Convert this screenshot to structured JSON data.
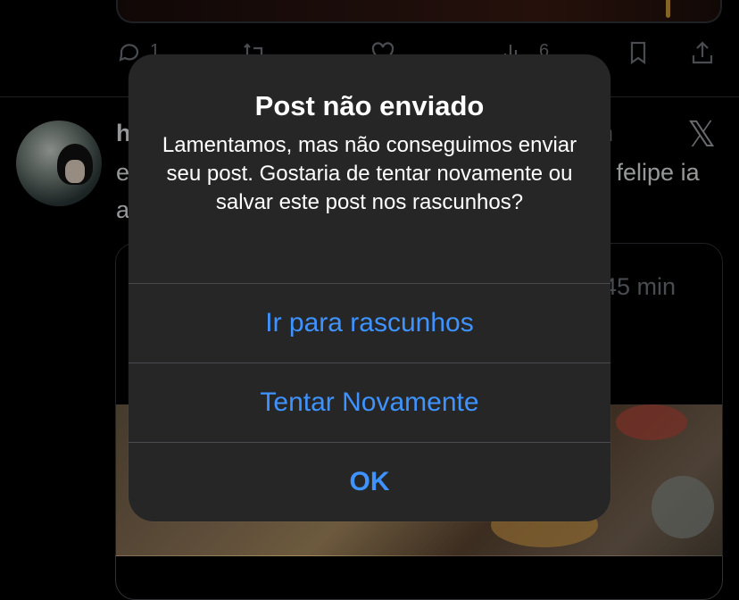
{
  "feed": {
    "actions": {
      "reply_count": "1",
      "views_count": "6"
    },
    "post": {
      "author_initial": "h",
      "line1_left": "e",
      "line1_right": "o felipe ia",
      "line2_left": "a",
      "timestamp_right": "n",
      "x_logo": "𝕏"
    },
    "quote": {
      "time": "45 min"
    }
  },
  "alert": {
    "title": "Post não enviado",
    "message": "Lamentamos, mas não conseguimos enviar seu post. Gostaria de tentar novamente ou salvar este post nos rascunhos?",
    "buttons": {
      "drafts": "Ir para rascunhos",
      "retry": "Tentar Novamente",
      "ok": "OK"
    },
    "accent_color": "#3e93ff",
    "background_color": "#262626"
  }
}
